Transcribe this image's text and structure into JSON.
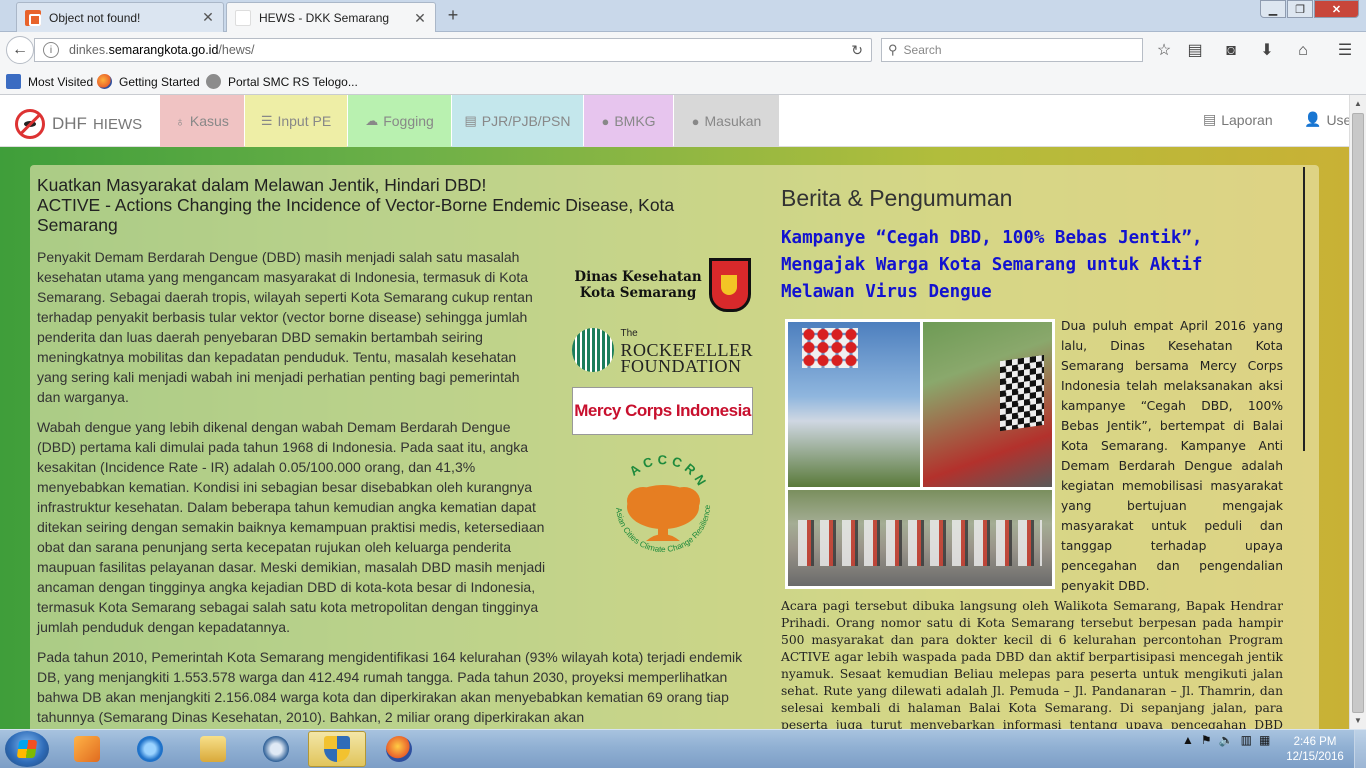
{
  "browser": {
    "tabs": [
      {
        "label": "Object not found!",
        "active": false
      },
      {
        "label": "HEWS - DKK Semarang",
        "active": true
      }
    ],
    "new_tab_symbol": "+",
    "url": {
      "prefix": "dinkes.",
      "host": "semarangkota.go.id",
      "path": "/hews/"
    },
    "search_placeholder": "Search",
    "bookmarks": [
      "Most Visited",
      "Getting Started",
      "Portal SMC RS Telogo..."
    ],
    "icons": [
      "back-icon",
      "info-icon",
      "reload-icon",
      "star-icon",
      "reading-list-icon",
      "pocket-icon",
      "download-icon",
      "home-icon",
      "menu-icon"
    ]
  },
  "app": {
    "brand": "DHF",
    "brand_sub": "HIEWS",
    "nav_tabs": [
      {
        "label": "Kasus",
        "icon": "stethoscope-icon",
        "color": "#f0c3c3"
      },
      {
        "label": "Input PE",
        "icon": "list-icon",
        "color": "#eeeea6"
      },
      {
        "label": "Fogging",
        "icon": "cloud-icon",
        "color": "#b9f1b0"
      },
      {
        "label": "PJR/PJB/PSN",
        "icon": "file-icon",
        "color": "#c4e7ec"
      },
      {
        "label": "BMKG",
        "icon": "comments-icon",
        "color": "#e7c5ee"
      },
      {
        "label": "Masukan",
        "icon": "comment-icon",
        "color": "#d8d8d8"
      }
    ],
    "right_links": [
      {
        "label": "Laporan",
        "icon": "book-icon"
      },
      {
        "label": "User",
        "icon": "user-icon"
      }
    ]
  },
  "main": {
    "heading_line1": "Kuatkan Masyarakat dalam Melawan Jentik, Hindari DBD!",
    "heading_line2": "ACTIVE - Actions Changing the Incidence of Vector-Borne Endemic Disease, Kota Semarang",
    "paragraphs": [
      "Penyakit Demam Berdarah Dengue (DBD) masih menjadi salah satu masalah kesehatan utama yang mengancam masyarakat di Indonesia, termasuk di Kota Semarang. Sebagai daerah tropis, wilayah seperti Kota Semarang cukup rentan terhadap penyakit berbasis tular vektor (vector borne disease) sehingga jumlah penderita dan luas daerah penyebaran DBD semakin bertambah seiring meningkatnya mobilitas dan kepadatan penduduk. Tentu, masalah kesehatan yang sering kali menjadi wabah ini menjadi perhatian penting bagi pemerintah dan warganya.",
      "Wabah dengue yang lebih dikenal dengan wabah Demam Berdarah Dengue (DBD) pertama kali dimulai pada tahun 1968 di Indonesia. Pada saat itu, angka kesakitan (Incidence Rate - IR) adalah 0.05/100.000 orang, dan 41,3% menyebabkan kematian. Kondisi ini sebagian besar disebabkan oleh kurangnya infrastruktur kesehatan. Dalam beberapa tahun kemudian angka kematian dapat ditekan seiring dengan semakin baiknya kemampuan praktisi medis, ketersediaan obat dan sarana penunjang serta kecepatan rujukan oleh keluarga penderita maupuan fasilitas pelayanan dasar. Meski demikian, masalah DBD masih menjadi ancaman dengan tingginya angka kejadian DBD di kota-kota besar di Indonesia, termasuk Kota Semarang sebagai salah satu kota metropolitan dengan tingginya jumlah penduduk dengan kepadatannya.",
      "Pada tahun 2010, Pemerintah Kota Semarang mengidentifikasi 164 kelurahan (93% wilayah kota) terjadi endemik DB, yang menjangkiti 1.553.578 warga dan 412.494 rumah tangga. Pada tahun 2030, proyeksi memperlihatkan bahwa DB akan menjangkiti 2.156.084 warga kota dan diperkirakan akan menyebabkan kematian 69 orang tiap tahunnya (Semarang Dinas Kesehatan, 2010). Bahkan, 2 miliar orang diperkirakan akan"
    ],
    "logos": {
      "dkk_line1": "Dinas Kesehatan",
      "dkk_line2": "Kota Semarang",
      "rf_the": "The",
      "rf_line1": "ROCKEFELLER",
      "rf_line2": "FOUNDATION",
      "mercy": "Mercy Corps Indonesia",
      "acccrn_top": "ACCCRN",
      "acccrn_ring": "Asian Cities Climate Change Resilience Network"
    }
  },
  "news": {
    "section_title": "Berita & Pengumuman",
    "article_title": "Kampanye “Cegah DBD, 100% Bebas Jentik”, Mengajak Warga Kota Semarang untuk Aktif Melawan Virus Dengue",
    "lead": "Dua puluh empat April 2016 yang lalu, Dinas Kesehatan Kota Semarang bersama Mercy Corps Indonesia telah melaksanakan aksi kampanye “Cegah DBD, 100% Bebas Jentik”, bertempat di Balai Kota Semarang. Kampanye Anti Demam Berdarah Dengue adalah kegiatan memobilisasi masyarakat yang bertujuan mengajak masyarakat untuk peduli dan tanggap terhadap upaya pencegahan dan pengendalian penyakit DBD.",
    "body": "Acara pagi tersebut dibuka langsung oleh Walikota Semarang, Bapak Hendrar Prihadi. Orang nomor satu di Kota Semarang tersebut berpesan pada hampir 500 masyarakat dan para dokter kecil di 6 kelurahan percontohan Program ACTIVE agar lebih waspada pada DBD dan aktif berpartisipasi mencegah jentik nyamuk. Sesaat kemudian Beliau melepas para peserta untuk mengikuti jalan sehat. Rute yang dilewati adalah Jl. Pemuda – Jl. Pandanaran – Jl. Thamrin, dan selesai kembali di halaman Balai Kota Semarang. Di sepanjang jalan, para peserta juga turut menyebarkan informasi tentang upaya pencegahan DBD pada masyarakat umum yang sedang mengikuti kegiatan Car Free"
  },
  "taskbar": {
    "clock_time": "2:46 PM",
    "clock_date": "12/15/2016",
    "apps": [
      "media-player-icon",
      "internet-explorer-icon",
      "file-explorer-icon",
      "network-globe-icon",
      "security-shield-icon",
      "firefox-icon"
    ]
  }
}
